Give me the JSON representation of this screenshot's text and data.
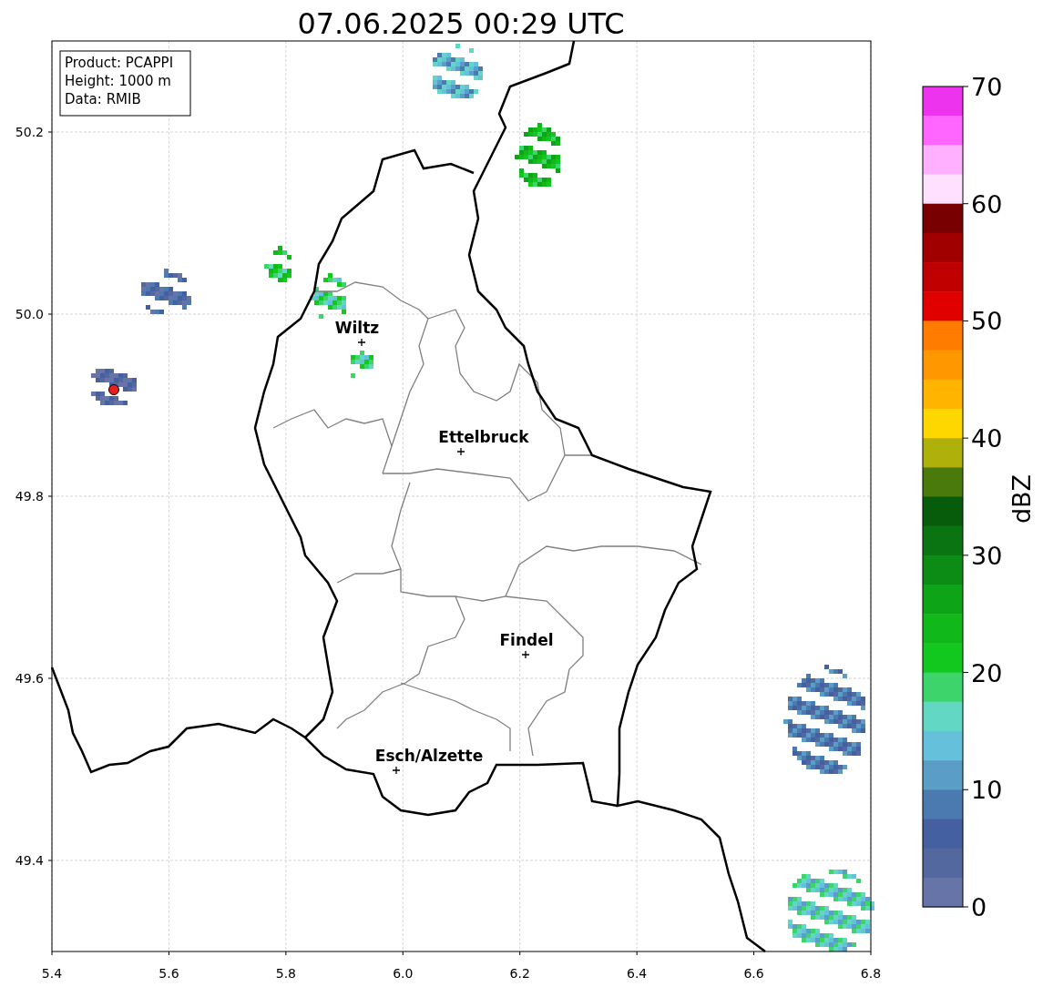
{
  "title": "07.06.2025 00:29 UTC",
  "info_box": [
    "Product: PCAPPI",
    "Height: 1000 m",
    "Data: RMIB"
  ],
  "map": {
    "xticks": [
      "5.4",
      "5.6",
      "5.8",
      "6.0",
      "6.2",
      "6.4",
      "6.6",
      "6.8"
    ],
    "yticks": [
      "50.2",
      "50.0",
      "49.8",
      "49.6",
      "49.4"
    ],
    "cities": [
      {
        "name": "Wiltz"
      },
      {
        "name": "Ettelbruck"
      },
      {
        "name": "Findel"
      },
      {
        "name": "Esch/Alzette"
      }
    ]
  },
  "colorbar": {
    "label": "dBZ",
    "ticks": [
      "70",
      "60",
      "50",
      "40",
      "30",
      "20",
      "10",
      "0"
    ],
    "segments": [
      {
        "color": "#ee33ee"
      },
      {
        "color": "#ff66ff"
      },
      {
        "color": "#ffb0ff"
      },
      {
        "color": "#ffe0ff"
      },
      {
        "color": "#780000"
      },
      {
        "color": "#a00000"
      },
      {
        "color": "#c00000"
      },
      {
        "color": "#e00000"
      },
      {
        "color": "#ff7c00"
      },
      {
        "color": "#ff9800"
      },
      {
        "color": "#ffb500"
      },
      {
        "color": "#ffd700"
      },
      {
        "color": "#b0b00a"
      },
      {
        "color": "#4a7a0c"
      },
      {
        "color": "#075c0c"
      },
      {
        "color": "#0a7412"
      },
      {
        "color": "#0c8c14"
      },
      {
        "color": "#0ea418"
      },
      {
        "color": "#10b81a"
      },
      {
        "color": "#12c81e"
      },
      {
        "color": "#3ed46c"
      },
      {
        "color": "#62d8c4"
      },
      {
        "color": "#65c0dc"
      },
      {
        "color": "#5a9ec8"
      },
      {
        "color": "#4a7ab0"
      },
      {
        "color": "#4560a0"
      },
      {
        "color": "#5468a0"
      },
      {
        "color": "#6674a8"
      }
    ]
  }
}
